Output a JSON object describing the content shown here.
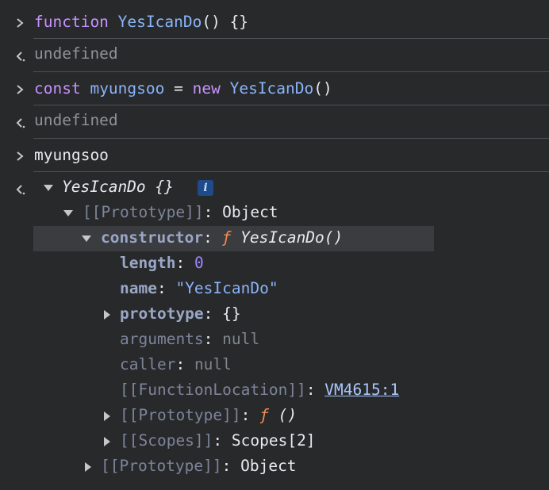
{
  "console": {
    "cmd1": {
      "kw": "function",
      "name": "YesIcanDo",
      "rest": "() {}"
    },
    "res1": "undefined",
    "cmd2": {
      "kw": "const",
      "var": "myungsoo",
      "eq": " = ",
      "kw2": "new",
      "cls": "YesIcanDo",
      "parens": "()"
    },
    "res2": "undefined",
    "cmd3": "myungsoo",
    "result": {
      "title": "YesIcanDo {}",
      "info": "i",
      "proto1": {
        "key": "[[Prototype]]",
        "value": "Object"
      },
      "constructor": {
        "key": "constructor",
        "f": "ƒ",
        "value": "YesIcanDo()"
      },
      "length": {
        "key": "length",
        "value": "0"
      },
      "name": {
        "key": "name",
        "value": "\"YesIcanDo\""
      },
      "prototype": {
        "key": "prototype",
        "value": "{}"
      },
      "arguments": {
        "key": "arguments",
        "value": "null"
      },
      "caller": {
        "key": "caller",
        "value": "null"
      },
      "fnloc": {
        "key": "[[FunctionLocation]]",
        "value": "VM4615:1"
      },
      "proto2": {
        "key": "[[Prototype]]",
        "f": "ƒ",
        "value": "()"
      },
      "scopes": {
        "key": "[[Scopes]]",
        "value": "Scopes[2]"
      },
      "proto3": {
        "key": "[[Prototype]]",
        "value": "Object"
      }
    }
  },
  "colors": {
    "background": "#28292b",
    "keyword": "#c792ff",
    "function": "#8ab4f8",
    "f_symbol": "#f28b54"
  }
}
